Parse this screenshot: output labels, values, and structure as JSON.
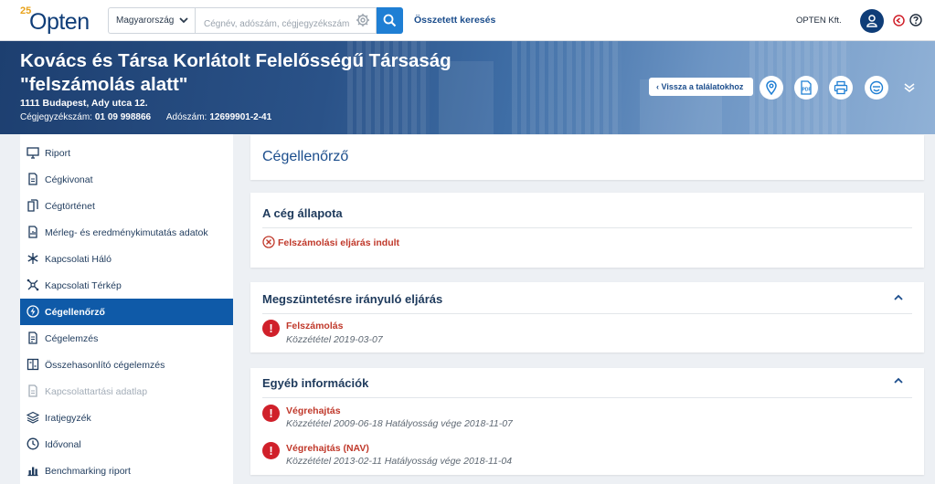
{
  "logo": {
    "anniversary": "25",
    "name": "Opten"
  },
  "header": {
    "country": "Magyarország",
    "search_placeholder": "Cégnév, adószám, cégjegyzékszám",
    "advanced_search": "Összetett keresés",
    "user": "OPTEN Kft."
  },
  "company": {
    "name": "Kovács és Társa Korlátolt Felelősségű Társaság \"felszámolás alatt\"",
    "address": "1111 Budapest, Ady utca 12.",
    "reg_label": "Cégjegyzékszám:",
    "reg_number": "01 09 998866",
    "tax_label": "Adószám:",
    "tax_number": "12699901-2-41",
    "back_label": "Vissza a találatokhoz"
  },
  "sidebar": {
    "items": [
      {
        "label": "Riport",
        "icon": "monitor-icon"
      },
      {
        "label": "Cégkivonat",
        "icon": "document-icon"
      },
      {
        "label": "Cégtörténet",
        "icon": "documents-icon"
      },
      {
        "label": "Mérleg- és eredménykimutatás adatok",
        "icon": "balance-icon"
      },
      {
        "label": "Kapcsolati Háló",
        "icon": "network-icon"
      },
      {
        "label": "Kapcsolati Térkép",
        "icon": "map-network-icon"
      },
      {
        "label": "Cégellenőrző",
        "icon": "bolt-icon"
      },
      {
        "label": "Cégelemzés",
        "icon": "analysis-icon"
      },
      {
        "label": "Összehasonlító cégelemzés",
        "icon": "compare-icon"
      },
      {
        "label": "Kapcsolattartási adatlap",
        "icon": "contact-icon"
      },
      {
        "label": "Iratjegyzék",
        "icon": "layers-icon"
      },
      {
        "label": "Idővonal",
        "icon": "clock-icon"
      },
      {
        "label": "Benchmarking riport",
        "icon": "chart-icon"
      }
    ]
  },
  "main": {
    "page_title": "Cégellenőrző",
    "status_card": {
      "title": "A cég állapota",
      "status": "Felszámolási eljárás indult"
    },
    "termination_card": {
      "title": "Megszüntetésre irányuló eljárás",
      "events": [
        {
          "title": "Felszámolás",
          "meta": "Közzététel 2019-03-07"
        }
      ]
    },
    "other_card": {
      "title": "Egyéb információk",
      "events": [
        {
          "title": "Végrehajtás",
          "meta": "Közzététel 2009-06-18 Hatályosság vége 2018-11-07"
        },
        {
          "title": "Végrehajtás (NAV)",
          "meta": "Közzététel 2013-02-11 Hatályosság vége 2018-11-04"
        }
      ]
    }
  },
  "colors": {
    "brand": "#0f3d78",
    "accent": "#1f7fd4",
    "active": "#0f5aa8",
    "danger": "#d0202a"
  }
}
